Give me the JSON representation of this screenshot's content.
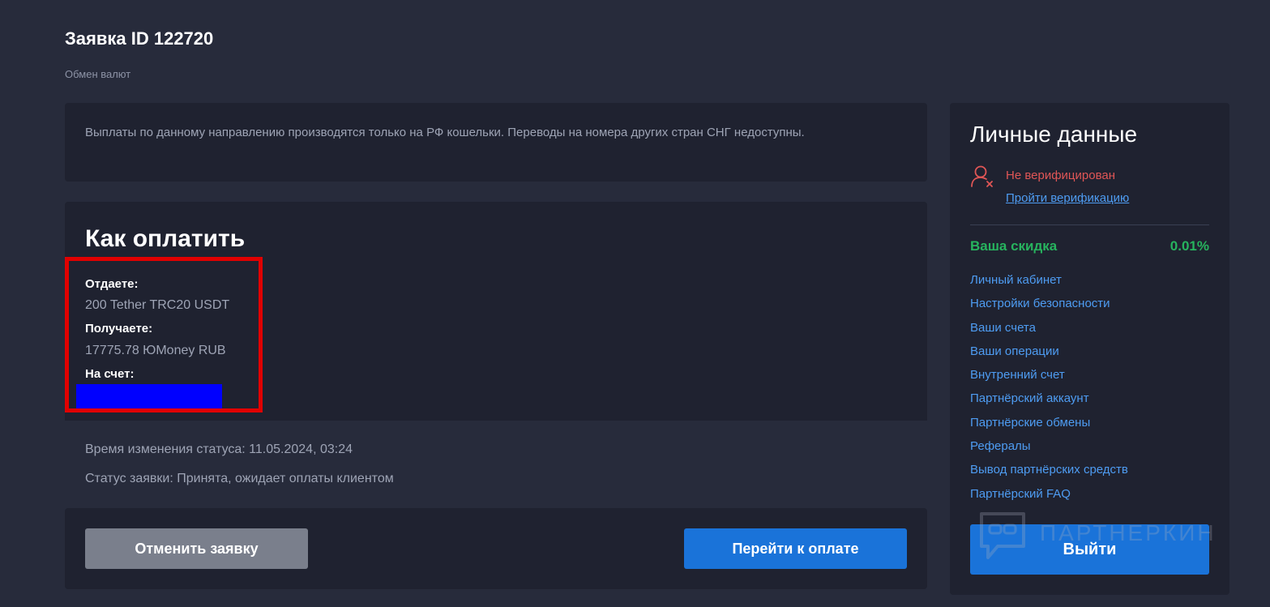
{
  "header": {
    "title": "Заявка ID 122720",
    "subtitle": "Обмен валют"
  },
  "notice": {
    "text": "Выплаты по данному направлению производятся только на РФ кошельки. Переводы на номера других стран СНГ недоступны."
  },
  "payment": {
    "title": "Как оплатить",
    "give_label": "Отдаете:",
    "give_value": "200 Tether TRC20 USDT",
    "receive_label": "Получаете:",
    "receive_value": "17775.78 ЮMoney RUB",
    "account_label": "На счет:"
  },
  "status": {
    "changed_time": "Время изменения статуса: 11.05.2024, 03:24",
    "order_status": "Статус заявки: Принята, ожидает оплаты клиентом"
  },
  "actions": {
    "cancel_label": "Отменить заявку",
    "pay_label": "Перейти к оплате"
  },
  "sidebar": {
    "title": "Личные данные",
    "verification_status": "Не верифицирован",
    "verify_link": "Пройти верификацию",
    "discount_label": "Ваша скидка",
    "discount_value": "0.01%",
    "nav": [
      "Личный кабинет",
      "Настройки безопасности",
      "Ваши счета",
      "Ваши операции",
      "Внутренний счет",
      "Партнёрский аккаунт",
      "Партнёрские обмены",
      "Рефералы",
      "Вывод партнёрских средств",
      "Партнёрский FAQ"
    ],
    "logout_label": "Выйти"
  },
  "watermark": {
    "text": "ПАРТНЕРКИН"
  },
  "colors": {
    "background": "#272b3b",
    "card": "#1f2230",
    "accent_blue": "#1a73d9",
    "link_blue": "#4e9cf2",
    "success_green": "#27b35e",
    "error_red": "#e05656",
    "highlight_red": "#e10000",
    "redaction_blue": "#0000ff"
  },
  "icons": {
    "verification": "user-x-icon",
    "watermark": "chat-bubble-icon"
  }
}
